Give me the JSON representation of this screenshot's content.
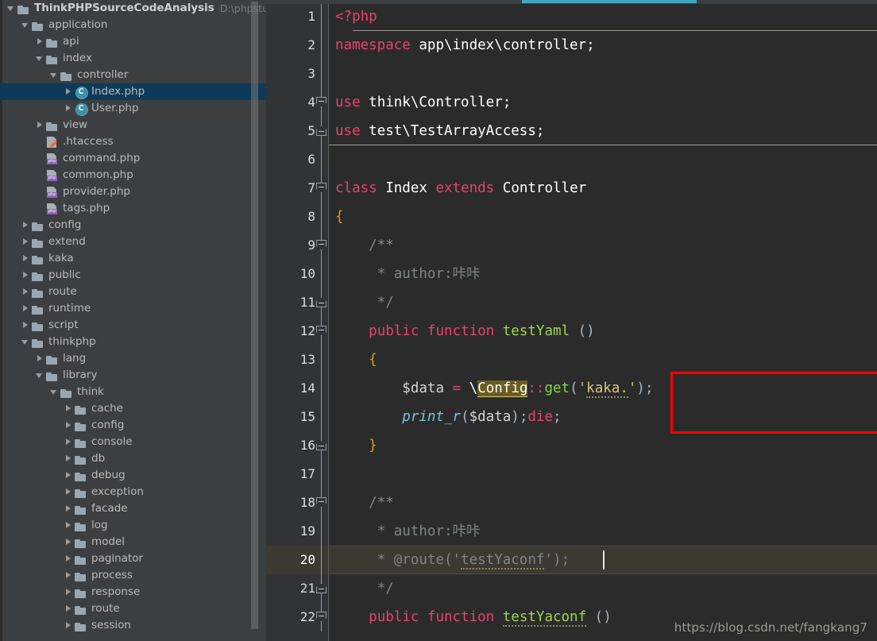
{
  "window": {
    "accent_blue": "#41a6c4",
    "editor_bg": "#2b2b2b",
    "gutter_bg": "#313335",
    "tree_bg": "#3c3f41",
    "selection_bg": "#0d3a58",
    "highlight_box_color": "#ff0000"
  },
  "project_tree": {
    "root": {
      "label": "ThinkPHPSourceCodeAnalysis",
      "path_hint": "D:\\phpstudy_pro\\"
    },
    "items": [
      {
        "label": "ThinkPHPSourceCodeAnalysis",
        "suffix": "D:\\phpstudy_pro\\",
        "indent": 0,
        "arrow": "down",
        "icon": "folder",
        "bold": true,
        "selected": false
      },
      {
        "label": "application",
        "suffix": "",
        "indent": 1,
        "arrow": "down",
        "icon": "folder",
        "bold": false,
        "selected": false
      },
      {
        "label": "api",
        "suffix": "",
        "indent": 2,
        "arrow": "right",
        "icon": "folder",
        "bold": false,
        "selected": false
      },
      {
        "label": "index",
        "suffix": "",
        "indent": 2,
        "arrow": "down",
        "icon": "folder",
        "bold": false,
        "selected": false
      },
      {
        "label": "controller",
        "suffix": "",
        "indent": 3,
        "arrow": "down",
        "icon": "folder",
        "bold": false,
        "selected": false
      },
      {
        "label": "Index.php",
        "suffix": "",
        "indent": 4,
        "arrow": "right",
        "icon": "class",
        "bold": false,
        "selected": true
      },
      {
        "label": "User.php",
        "suffix": "",
        "indent": 4,
        "arrow": "right",
        "icon": "class",
        "bold": false,
        "selected": false
      },
      {
        "label": "view",
        "suffix": "",
        "indent": 2,
        "arrow": "right",
        "icon": "folder",
        "bold": false,
        "selected": false
      },
      {
        "label": ".htaccess",
        "suffix": "",
        "indent": 2,
        "arrow": "none",
        "icon": "htaccess",
        "bold": false,
        "selected": false
      },
      {
        "label": "command.php",
        "suffix": "",
        "indent": 2,
        "arrow": "none",
        "icon": "php",
        "bold": false,
        "selected": false
      },
      {
        "label": "common.php",
        "suffix": "",
        "indent": 2,
        "arrow": "none",
        "icon": "php",
        "bold": false,
        "selected": false
      },
      {
        "label": "provider.php",
        "suffix": "",
        "indent": 2,
        "arrow": "none",
        "icon": "php",
        "bold": false,
        "selected": false
      },
      {
        "label": "tags.php",
        "suffix": "",
        "indent": 2,
        "arrow": "none",
        "icon": "php",
        "bold": false,
        "selected": false
      },
      {
        "label": "config",
        "suffix": "",
        "indent": 1,
        "arrow": "right",
        "icon": "folder",
        "bold": false,
        "selected": false
      },
      {
        "label": "extend",
        "suffix": "",
        "indent": 1,
        "arrow": "right",
        "icon": "folder",
        "bold": false,
        "selected": false
      },
      {
        "label": "kaka",
        "suffix": "",
        "indent": 1,
        "arrow": "right",
        "icon": "folder",
        "bold": false,
        "selected": false
      },
      {
        "label": "public",
        "suffix": "",
        "indent": 1,
        "arrow": "right",
        "icon": "folder",
        "bold": false,
        "selected": false
      },
      {
        "label": "route",
        "suffix": "",
        "indent": 1,
        "arrow": "right",
        "icon": "folder",
        "bold": false,
        "selected": false
      },
      {
        "label": "runtime",
        "suffix": "",
        "indent": 1,
        "arrow": "right",
        "icon": "folder",
        "bold": false,
        "selected": false
      },
      {
        "label": "script",
        "suffix": "",
        "indent": 1,
        "arrow": "right",
        "icon": "folder",
        "bold": false,
        "selected": false
      },
      {
        "label": "thinkphp",
        "suffix": "",
        "indent": 1,
        "arrow": "down",
        "icon": "folder",
        "bold": false,
        "selected": false
      },
      {
        "label": "lang",
        "suffix": "",
        "indent": 2,
        "arrow": "right",
        "icon": "folder",
        "bold": false,
        "selected": false
      },
      {
        "label": "library",
        "suffix": "",
        "indent": 2,
        "arrow": "down",
        "icon": "folder",
        "bold": false,
        "selected": false
      },
      {
        "label": "think",
        "suffix": "",
        "indent": 3,
        "arrow": "down",
        "icon": "folder",
        "bold": false,
        "selected": false
      },
      {
        "label": "cache",
        "suffix": "",
        "indent": 4,
        "arrow": "right",
        "icon": "folder",
        "bold": false,
        "selected": false
      },
      {
        "label": "config",
        "suffix": "",
        "indent": 4,
        "arrow": "right",
        "icon": "folder",
        "bold": false,
        "selected": false
      },
      {
        "label": "console",
        "suffix": "",
        "indent": 4,
        "arrow": "right",
        "icon": "folder",
        "bold": false,
        "selected": false
      },
      {
        "label": "db",
        "suffix": "",
        "indent": 4,
        "arrow": "right",
        "icon": "folder",
        "bold": false,
        "selected": false
      },
      {
        "label": "debug",
        "suffix": "",
        "indent": 4,
        "arrow": "right",
        "icon": "folder",
        "bold": false,
        "selected": false
      },
      {
        "label": "exception",
        "suffix": "",
        "indent": 4,
        "arrow": "right",
        "icon": "folder",
        "bold": false,
        "selected": false
      },
      {
        "label": "facade",
        "suffix": "",
        "indent": 4,
        "arrow": "right",
        "icon": "folder",
        "bold": false,
        "selected": false
      },
      {
        "label": "log",
        "suffix": "",
        "indent": 4,
        "arrow": "right",
        "icon": "folder",
        "bold": false,
        "selected": false
      },
      {
        "label": "model",
        "suffix": "",
        "indent": 4,
        "arrow": "right",
        "icon": "folder",
        "bold": false,
        "selected": false
      },
      {
        "label": "paginator",
        "suffix": "",
        "indent": 4,
        "arrow": "right",
        "icon": "folder",
        "bold": false,
        "selected": false
      },
      {
        "label": "process",
        "suffix": "",
        "indent": 4,
        "arrow": "right",
        "icon": "folder",
        "bold": false,
        "selected": false
      },
      {
        "label": "response",
        "suffix": "",
        "indent": 4,
        "arrow": "right",
        "icon": "folder",
        "bold": false,
        "selected": false
      },
      {
        "label": "route",
        "suffix": "",
        "indent": 4,
        "arrow": "right",
        "icon": "folder",
        "bold": false,
        "selected": false
      },
      {
        "label": "session",
        "suffix": "",
        "indent": 4,
        "arrow": "right",
        "icon": "folder",
        "bold": false,
        "selected": false
      }
    ]
  },
  "editor": {
    "current_line": 20,
    "line_numbers": [
      1,
      2,
      3,
      4,
      5,
      6,
      7,
      8,
      9,
      10,
      11,
      12,
      13,
      14,
      15,
      16,
      17,
      18,
      19,
      20,
      21,
      22
    ],
    "lines": [
      {
        "n": 1,
        "text": "<?php"
      },
      {
        "n": 2,
        "text": "namespace app\\index\\controller;"
      },
      {
        "n": 3,
        "text": ""
      },
      {
        "n": 4,
        "text": "use think\\Controller;"
      },
      {
        "n": 5,
        "text": "use test\\TestArrayAccess;"
      },
      {
        "n": 6,
        "text": ""
      },
      {
        "n": 7,
        "text": "class Index extends Controller"
      },
      {
        "n": 8,
        "text": "{"
      },
      {
        "n": 9,
        "text": "    /**"
      },
      {
        "n": 10,
        "text": "     * author:咔咔"
      },
      {
        "n": 11,
        "text": "     */"
      },
      {
        "n": 12,
        "text": "    public function testYaml ()"
      },
      {
        "n": 13,
        "text": "    {"
      },
      {
        "n": 14,
        "text": "        $data = \\Config::get('kaka.');"
      },
      {
        "n": 15,
        "text": "        print_r($data);die;"
      },
      {
        "n": 16,
        "text": "    }"
      },
      {
        "n": 17,
        "text": ""
      },
      {
        "n": 18,
        "text": "    /**"
      },
      {
        "n": 19,
        "text": "     * author:咔咔"
      },
      {
        "n": 20,
        "text": "     * @route('testYaconf');"
      },
      {
        "n": 21,
        "text": "     */"
      },
      {
        "n": 22,
        "text": "    public function testYaconf ()"
      }
    ],
    "highlighted_identifier": "Config",
    "highlighted_block_lines": [
      14,
      15
    ]
  },
  "watermark": {
    "text": "https://blog.csdn.net/fangkang7"
  }
}
